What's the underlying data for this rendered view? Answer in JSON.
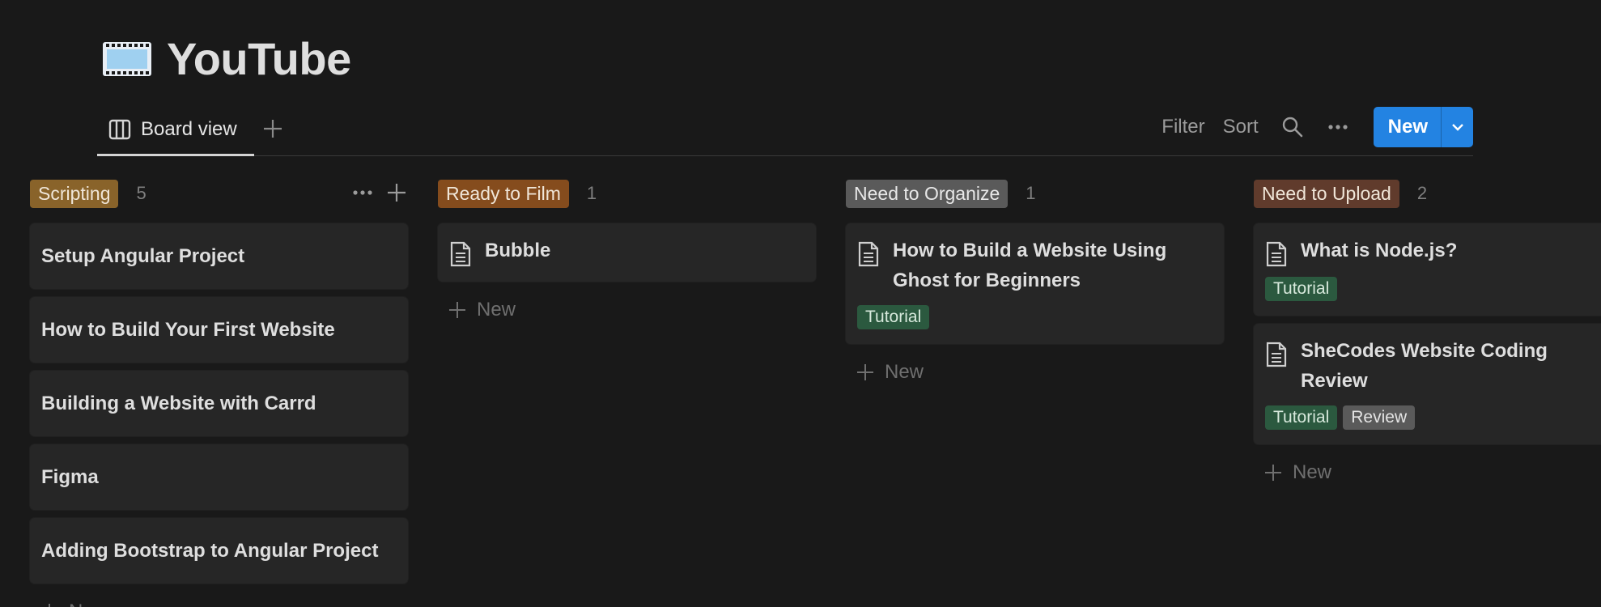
{
  "page": {
    "title": "YouTube",
    "icon": "film-icon"
  },
  "toolbar": {
    "view_tab": "Board view",
    "filter_label": "Filter",
    "sort_label": "Sort",
    "new_label": "New"
  },
  "colors": {
    "background": "#191919",
    "card": "#262626",
    "accent": "#2383e2",
    "scripting": "#89632a",
    "ready_to_film": "#854c1d",
    "need_to_organize": "#5a5a5a",
    "need_to_upload": "#603b2c",
    "tag_tutorial": "#2b593f",
    "tag_review": "#5a5a5a"
  },
  "columns": [
    {
      "name": "Scripting",
      "count": "5",
      "cards": [
        {
          "title": "Setup Angular Project"
        },
        {
          "title": "How to Build Your First Website"
        },
        {
          "title": "Building a Website with Carrd"
        },
        {
          "title": "Figma"
        },
        {
          "title": "Adding Bootstrap to Angular Project"
        }
      ],
      "new_label": "New"
    },
    {
      "name": "Ready to Film",
      "count": "1",
      "cards": [
        {
          "title": "Bubble"
        }
      ],
      "new_label": "New"
    },
    {
      "name": "Need to Organize",
      "count": "1",
      "cards": [
        {
          "title": "How to Build a Website Using Ghost for Beginners",
          "tags": [
            "Tutorial"
          ]
        }
      ],
      "new_label": "New"
    },
    {
      "name": "Need to Upload",
      "count": "2",
      "cards": [
        {
          "title": "What is Node.js?",
          "tags": [
            "Tutorial"
          ]
        },
        {
          "title": "SheCodes Website Coding Review",
          "tags": [
            "Tutorial",
            "Review"
          ]
        }
      ],
      "new_label": "New"
    }
  ]
}
